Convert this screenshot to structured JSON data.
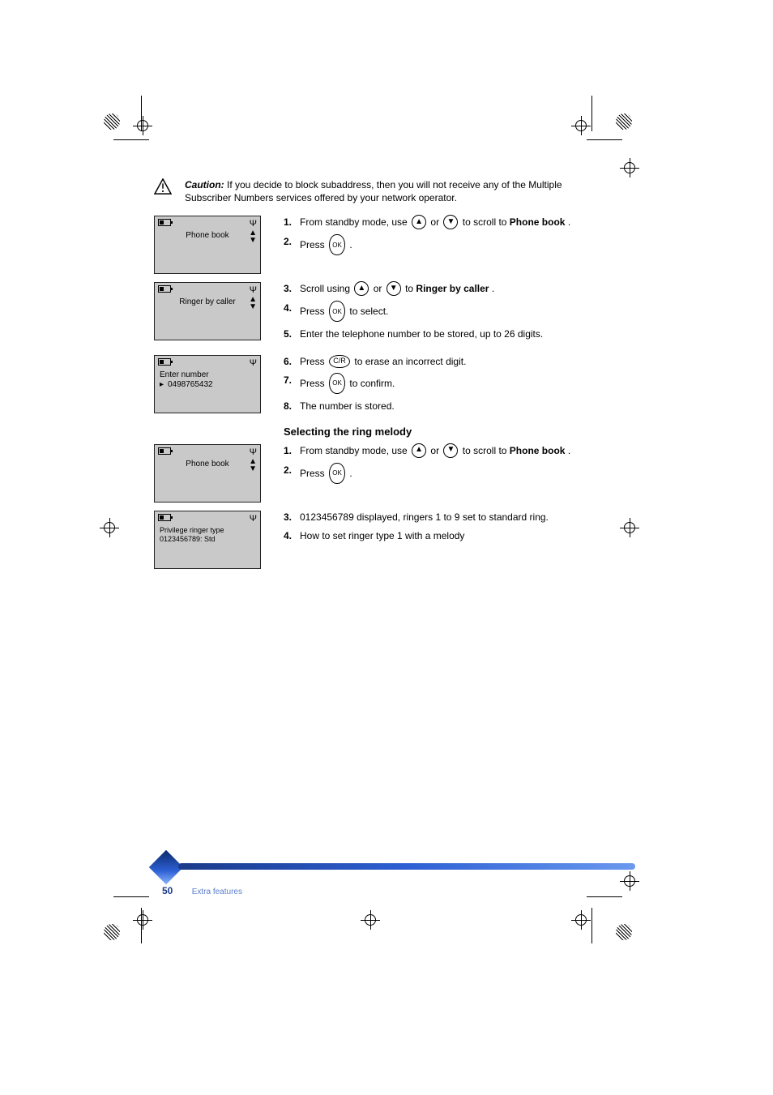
{
  "caution": {
    "bold": "Caution:",
    "text": " If you decide to block subaddress, then you will not receive any of the Multiple Subscriber Numbers services offered by your network operator."
  },
  "steps_store": {
    "s1": "From standby mode, use ",
    "s1b": " or ",
    "s1c": " to scroll to ",
    "s1d": "Phone book",
    "s1e": ".",
    "s2a": "Press ",
    "s2b": ".",
    "s3a": "Scroll using ",
    "s3b": " or ",
    "s3c": " to ",
    "s3d": "Ringer by caller",
    "s3e": ".",
    "s4a": "Press ",
    "s4b": " to select.",
    "s5a": "Enter the telephone number to be stored, up to 26 digits.",
    "s6a": "Press ",
    "s6b": " to erase an incorrect digit.",
    "s7a": "Press ",
    "s7b": " to confirm.",
    "s8a": "The number is stored."
  },
  "steps_select": {
    "title": "Selecting the ring melody",
    "s1": "From standby mode, use ",
    "s1b": " or ",
    "s1c": " to scroll to ",
    "s1d": "Phone book",
    "s1e": ".",
    "s2a": "Press ",
    "s2b": ".",
    "s3a": "0123456789 displayed, ringers 1 to 9 set to standard ring.",
    "s4a": "How to set ringer type 1 with a melody"
  },
  "lcd1": {
    "title": "Phone book"
  },
  "lcd2": {
    "title": "Ringer by caller"
  },
  "lcd3": {
    "row1": "Enter number",
    "row2": "0498765432"
  },
  "lcd4": {
    "title": "Phone book"
  },
  "lcd5": {
    "row1": "Privilege ringer type",
    "row2": "0123456789: Std"
  },
  "footer": {
    "page": "50",
    "section": "Extra features"
  },
  "icons": {
    "ok": "OK",
    "c": "C/R",
    "up": "▲",
    "down": "▼"
  }
}
